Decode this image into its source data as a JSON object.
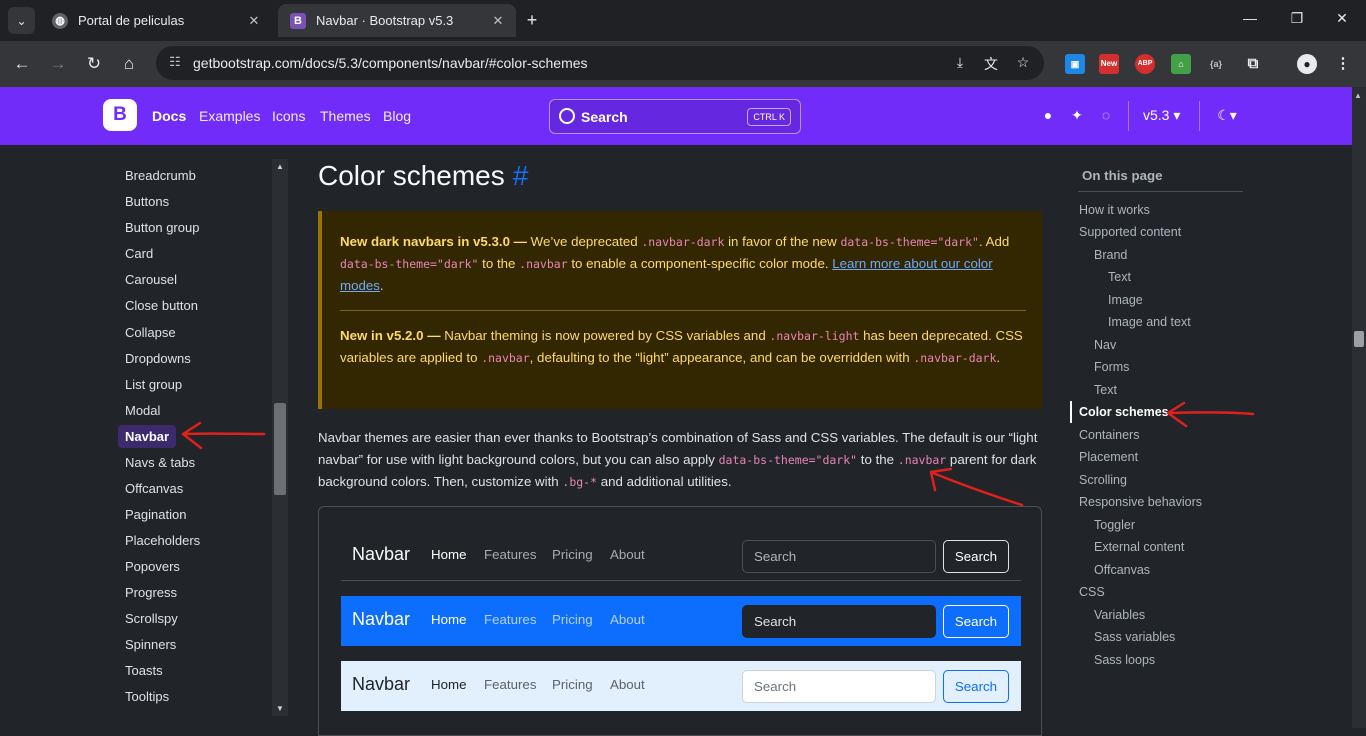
{
  "browser": {
    "tabs": [
      {
        "title": "Portal de peliculas",
        "active": false
      },
      {
        "title": "Navbar · Bootstrap v5.3",
        "active": true
      }
    ],
    "url": "getbootstrap.com/docs/5.3/components/navbar/#color-schemes",
    "extensions": [
      "New",
      "ABP",
      "{a}"
    ]
  },
  "topnav": {
    "brand_letter": "B",
    "links": [
      "Docs",
      "Examples",
      "Icons",
      "Themes",
      "Blog"
    ],
    "search_label": "Search",
    "search_kbd": "CTRL K",
    "version": "v5.3"
  },
  "sidebar": {
    "items": [
      "Breadcrumb",
      "Buttons",
      "Button group",
      "Card",
      "Carousel",
      "Close button",
      "Collapse",
      "Dropdowns",
      "List group",
      "Modal",
      "Navbar",
      "Navs & tabs",
      "Offcanvas",
      "Pagination",
      "Placeholders",
      "Popovers",
      "Progress",
      "Scrollspy",
      "Spinners",
      "Toasts",
      "Tooltips"
    ],
    "active": "Navbar"
  },
  "main": {
    "title": "Color schemes",
    "anchor": "#",
    "callout1": {
      "bold": "New dark navbars in v5.3.0 —",
      "t1": " We’ve deprecated ",
      "c1": ".navbar-dark",
      "t2": " in favor of the new ",
      "c2": "data-bs-theme=\"dark\"",
      "t3": ". Add ",
      "c3": "data-bs-theme=\"dark\"",
      "t4": " to the ",
      "c4": ".navbar",
      "t5": " to enable a component-specific color mode. ",
      "link": "Learn more about our color modes",
      "t6": "."
    },
    "callout2": {
      "bold": "New in v5.2.0 —",
      "t1": " Navbar theming is now powered by CSS variables and ",
      "c1": ".navbar-light",
      "t2": " has been deprecated. CSS variables are applied to ",
      "c2": ".navbar",
      "t3": ", defaulting to the “light” appearance, and can be overridden with ",
      "c3": ".navbar-dark",
      "t4": "."
    },
    "intro": {
      "t1": "Navbar themes are easier than ever thanks to Bootstrap’s combination of Sass and CSS variables. The default is our “light navbar” for use with light background colors, but you can also apply ",
      "c1": "data-bs-theme=\"dark\"",
      "t2": " to the ",
      "c2": ".navbar",
      "t3": " parent for dark background colors. Then, customize with ",
      "c3": ".bg-*",
      "t4": " and additional utilities."
    },
    "examples": [
      {
        "brand": "Navbar",
        "links": [
          "Home",
          "Features",
          "Pricing",
          "About"
        ],
        "search_placeholder": "Search",
        "button": "Search",
        "bg": "#212529"
      },
      {
        "brand": "Navbar",
        "links": [
          "Home",
          "Features",
          "Pricing",
          "About"
        ],
        "search_placeholder": "Search",
        "button": "Search",
        "bg": "#0d6efd"
      },
      {
        "brand": "Navbar",
        "links": [
          "Home",
          "Features",
          "Pricing",
          "About"
        ],
        "search_placeholder": "Search",
        "button": "Search",
        "bg": "#e2effd"
      }
    ]
  },
  "toc": {
    "title": "On this page",
    "items": [
      {
        "label": "How it works",
        "level": 0
      },
      {
        "label": "Supported content",
        "level": 0
      },
      {
        "label": "Brand",
        "level": 1
      },
      {
        "label": "Text",
        "level": 2
      },
      {
        "label": "Image",
        "level": 2
      },
      {
        "label": "Image and text",
        "level": 2
      },
      {
        "label": "Nav",
        "level": 1
      },
      {
        "label": "Forms",
        "level": 1
      },
      {
        "label": "Text",
        "level": 1
      },
      {
        "label": "Color schemes",
        "level": 0
      },
      {
        "label": "Containers",
        "level": 0
      },
      {
        "label": "Placement",
        "level": 0
      },
      {
        "label": "Scrolling",
        "level": 0
      },
      {
        "label": "Responsive behaviors",
        "level": 0
      },
      {
        "label": "Toggler",
        "level": 1
      },
      {
        "label": "External content",
        "level": 1
      },
      {
        "label": "Offcanvas",
        "level": 1
      },
      {
        "label": "CSS",
        "level": 0
      },
      {
        "label": "Variables",
        "level": 1
      },
      {
        "label": "Sass variables",
        "level": 1
      },
      {
        "label": "Sass loops",
        "level": 1
      }
    ],
    "active": "Color schemes"
  },
  "colors": {
    "accent": "#712cf9",
    "annotation": "#e0201b"
  }
}
